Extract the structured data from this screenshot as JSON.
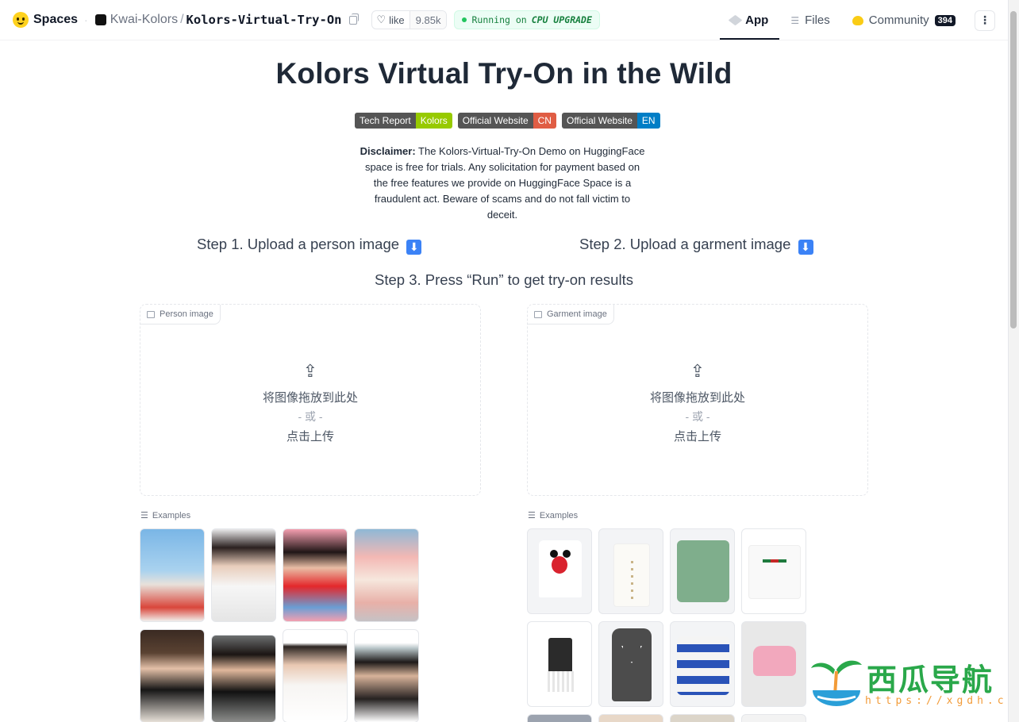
{
  "header": {
    "brand": "Spaces",
    "org": "Kwai-Kolors",
    "repo": "Kolors-Virtual-Try-On",
    "like_label": "like",
    "like_count": "9.85k",
    "status_prefix": "Running on",
    "status_hw": "CPU UPGRADE",
    "nav": {
      "app": "App",
      "files": "Files",
      "community": "Community",
      "community_count": "394"
    }
  },
  "main": {
    "title": "Kolors Virtual Try-On in the Wild",
    "badges": [
      {
        "key": "Tech Report",
        "value": "Kolors",
        "color": "#97ca00"
      },
      {
        "key": "Official Website",
        "value": "CN",
        "color": "#e05d44"
      },
      {
        "key": "Official Website",
        "value": "EN",
        "color": "#007ec6"
      }
    ],
    "disclaimer_label": "Disclaimer:",
    "disclaimer_text": "The Kolors-Virtual-Try-On Demo on HuggingFace space is free for trials. Any solicitation for payment based on the free features we provide on HuggingFace Space is a fraudulent act. Beware of scams and do not fall victim to deceit.",
    "step1": "Step 1. Upload a person image",
    "step2": "Step 2. Upload a garment image",
    "step3": "Step 3. Press “Run” to get try-on results",
    "arrow_glyph": "⬇",
    "person_uploader": {
      "label": "Person image",
      "drop_text": "将图像拖放到此处",
      "or_text": "- 或 -",
      "click_text": "点击上传"
    },
    "garment_uploader": {
      "label": "Garment image",
      "drop_text": "将图像拖放到此处",
      "or_text": "- 或 -",
      "click_text": "点击上传"
    },
    "examples_label": "Examples"
  },
  "watermark": {
    "text": "西瓜导航",
    "url": "https://xgdh.cn"
  },
  "colors": {
    "accent": "#111827",
    "status_green": "#22c55e",
    "badge_dark": "#555555"
  }
}
